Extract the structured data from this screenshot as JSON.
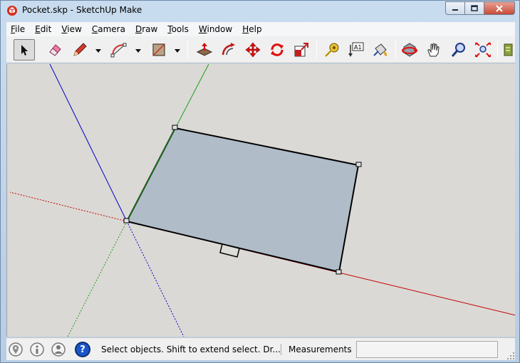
{
  "window": {
    "title": "Pocket.skp - SketchUp Make"
  },
  "menubar": {
    "items": [
      "File",
      "Edit",
      "View",
      "Camera",
      "Draw",
      "Tools",
      "Window",
      "Help"
    ]
  },
  "toolbar": {
    "tools": [
      {
        "icon": "select-arrow-icon",
        "selected": true
      },
      {
        "icon": "eraser-icon"
      },
      {
        "icon": "pencil-line-icon"
      },
      {
        "icon": "arc-icon"
      },
      {
        "icon": "rectangle-shape-icon"
      },
      {
        "icon": "push-pull-icon"
      },
      {
        "icon": "offset-icon"
      },
      {
        "icon": "move-icon"
      },
      {
        "icon": "rotate-icon"
      },
      {
        "icon": "scale-icon"
      },
      {
        "icon": "tape-measure-icon"
      },
      {
        "icon": "text-label-icon"
      },
      {
        "icon": "paint-bucket-icon"
      },
      {
        "icon": "orbit-icon"
      },
      {
        "icon": "pan-hand-icon"
      },
      {
        "icon": "zoom-icon"
      },
      {
        "icon": "zoom-extents-icon"
      },
      {
        "icon": "warehouse-icon"
      }
    ],
    "text_tool_glyph": "A1"
  },
  "colors": {
    "viewport_bg": "#dbd9d5",
    "face_fill": "#b0bcc8",
    "red_axis": "#c00000",
    "green_axis": "#18a018",
    "blue_axis": "#0000c8",
    "accent_red": "#e01010"
  },
  "statusbar": {
    "icons": [
      "geo-location-icon",
      "credits-icon",
      "user-account-icon",
      "help-icon"
    ],
    "help_glyph": "?",
    "message": "Select objects. Shift to extend select. Dr...",
    "measurements_label": "Measurements",
    "measurements_value": ""
  }
}
